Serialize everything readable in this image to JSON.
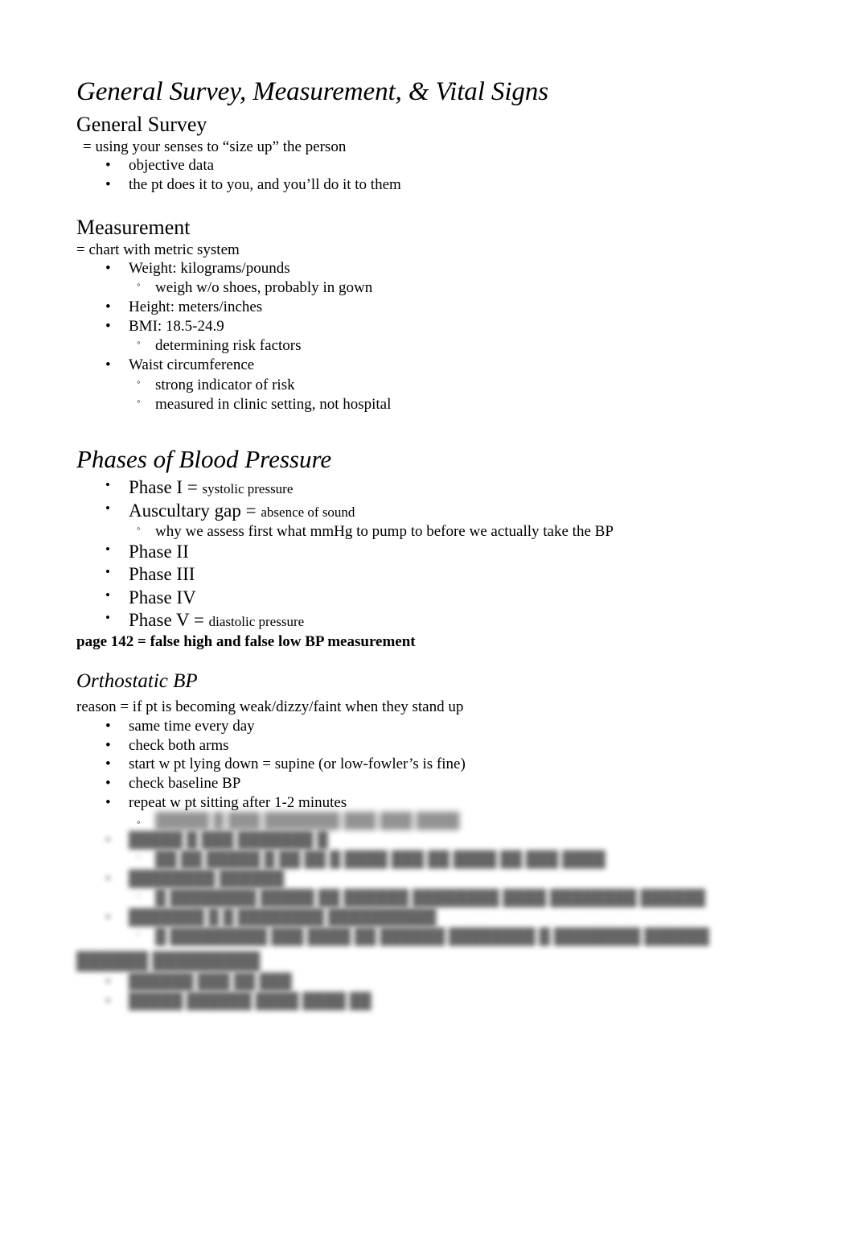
{
  "document": {
    "title": "General Survey, Measurement, & Vital Signs"
  },
  "sections": {
    "general_survey": {
      "heading": "General Survey",
      "lead": "= using your senses to “size up” the person",
      "bullets": [
        {
          "marker": "•",
          "text": "objective data"
        },
        {
          "marker": "•",
          "text": "the pt does it to you, and you’ll do it to them"
        }
      ]
    },
    "measurement": {
      "heading": "Measurement",
      "lead": "= chart with metric system",
      "items": [
        {
          "marker": "•",
          "level": 1,
          "text": "Weight: kilograms/pounds"
        },
        {
          "marker": "◦",
          "level": 2,
          "text": "weigh w/o shoes, probably in gown"
        },
        {
          "marker": "•",
          "level": 1,
          "text": "Height: meters/inches"
        },
        {
          "marker": "•",
          "level": 1,
          "text": "BMI: 18.5-24.9"
        },
        {
          "marker": "◦",
          "level": 2,
          "text": "determining risk factors"
        },
        {
          "marker": "•",
          "level": 1,
          "text": "Waist circumference"
        },
        {
          "marker": "◦",
          "level": 2,
          "text": "strong indicator of risk"
        },
        {
          "marker": "◦",
          "level": 2,
          "text": "measured in clinic setting, not hospital"
        }
      ]
    },
    "phases_of_blood_pressure": {
      "heading": "Phases of Blood Pressure",
      "items": [
        {
          "marker": "•",
          "level": 1,
          "big": true,
          "text": "Phase I = ",
          "small": "systolic pressure"
        },
        {
          "marker": "•",
          "level": 1,
          "big": true,
          "text": "Auscultary gap = ",
          "small": "absence of sound"
        },
        {
          "marker": "◦",
          "level": 2,
          "big": false,
          "text": "why we assess first what mmHg to pump to before we actually take the BP",
          "small": ""
        },
        {
          "marker": "•",
          "level": 1,
          "big": true,
          "text": "Phase II",
          "small": ""
        },
        {
          "marker": "•",
          "level": 1,
          "big": true,
          "text": "Phase III",
          "small": ""
        },
        {
          "marker": "•",
          "level": 1,
          "big": true,
          "text": "Phase IV",
          "small": ""
        },
        {
          "marker": "•",
          "level": 1,
          "big": true,
          "text": "Phase V = ",
          "small": "diastolic pressure"
        }
      ],
      "footnote": "page 142 = false high and false low BP measurement"
    },
    "orthostatic_bp": {
      "heading": "Orthostatic BP",
      "lead": "reason = if pt is becoming weak/dizzy/faint when they stand up",
      "bullets": [
        {
          "marker": "•",
          "text": "same time every day"
        },
        {
          "marker": "•",
          "text": "check both arms"
        },
        {
          "marker": "•",
          "text": "start w pt lying down = supine (or low-fowler’s is fine)"
        },
        {
          "marker": "•",
          "text": "check baseline BP"
        },
        {
          "marker": "•",
          "text": "repeat w pt sitting after 1-2 minutes"
        }
      ]
    },
    "faded_tail": {
      "note": "remaining lines are blurred / illegible in the source image",
      "lines": [
        {
          "marker": "◦",
          "level": 2,
          "placeholder": "█████  █  ███ ███████ ███ ███ ████"
        },
        {
          "marker": "•",
          "level": 1,
          "placeholder": "█████ █ ███ ███████ █"
        },
        {
          "marker": "◦",
          "level": 2,
          "placeholder": "██ ██ █████ █ ██ ██  █ ████ ███ ██ ████ ██ ███ ████"
        },
        {
          "marker": "•",
          "level": 1,
          "placeholder": "████████ ██████"
        },
        {
          "marker": "◦",
          "level": 2,
          "placeholder": "█ ████████  █████ ██ ██████ ████████ ████ ████████ ██████"
        },
        {
          "marker": "•",
          "level": 1,
          "placeholder": "███████ █ █ ████████ ██████████"
        },
        {
          "marker": "◦",
          "level": 2,
          "placeholder": "█ █████████ ███ ████ ██ ██████ ████████ █ ████████ ██████"
        }
      ],
      "heading_placeholder": "██████ █████████",
      "heading_lines": [
        {
          "marker": "•",
          "level": 1,
          "placeholder": "██████ ███ ██ ███"
        },
        {
          "marker": "•",
          "level": 1,
          "placeholder": "█████ ██████ ████ ████ ██"
        }
      ]
    }
  }
}
